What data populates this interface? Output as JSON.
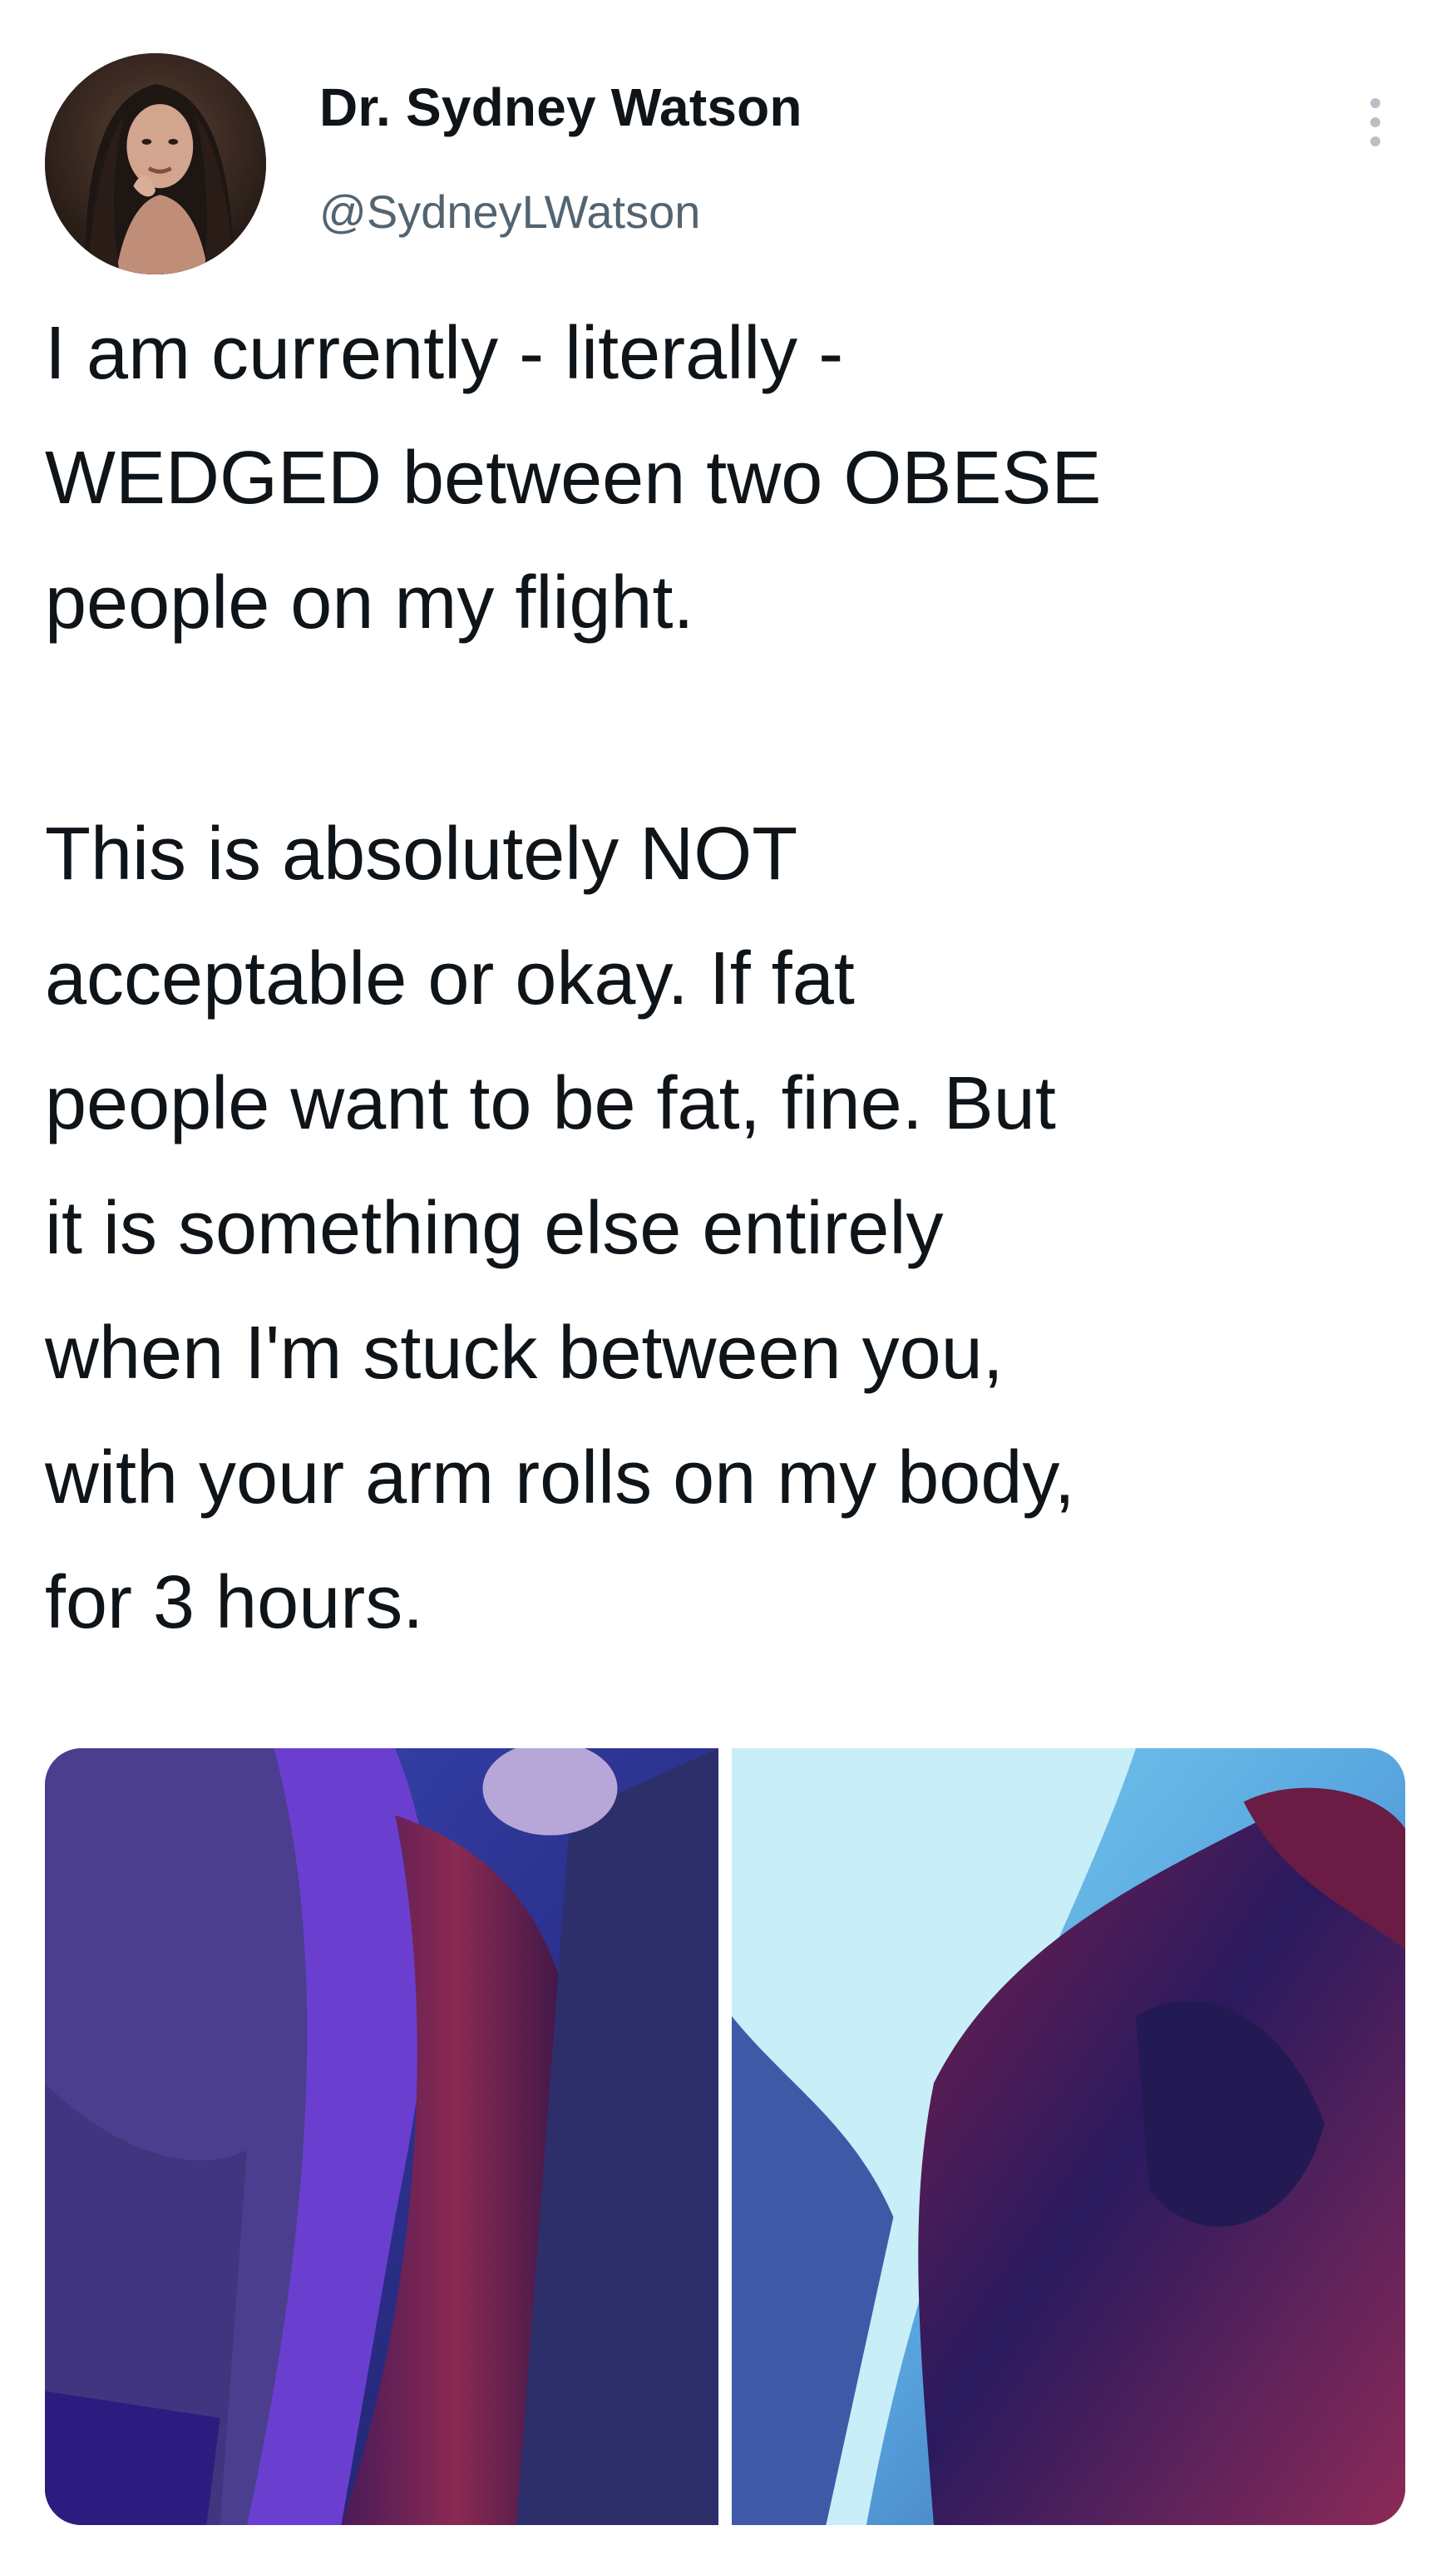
{
  "author": {
    "display_name": "Dr. Sydney Watson",
    "handle": "@SydneyLWatson",
    "avatar_icon": "profile-photo"
  },
  "menu": {
    "icon": "more-vertical-icon"
  },
  "tweet": {
    "paragraphs": [
      {
        "lines": [
          "I am currently - literally -",
          "WEDGED between two OBESE",
          "people on my flight."
        ]
      },
      {
        "lines": [
          "This is absolutely NOT",
          "acceptable or okay. If fat",
          "people want to be fat, fine. But",
          "it is something else entirely",
          "when I'm stuck between you,",
          "with your arm rolls on my body,",
          "for 3 hours."
        ]
      }
    ]
  },
  "media": {
    "photos": [
      {
        "icon": "airplane-seat-photo-1"
      },
      {
        "icon": "airplane-seat-photo-2"
      }
    ]
  },
  "colors": {
    "text": "#0f1419",
    "secondary": "#536471",
    "background": "#ffffff"
  }
}
